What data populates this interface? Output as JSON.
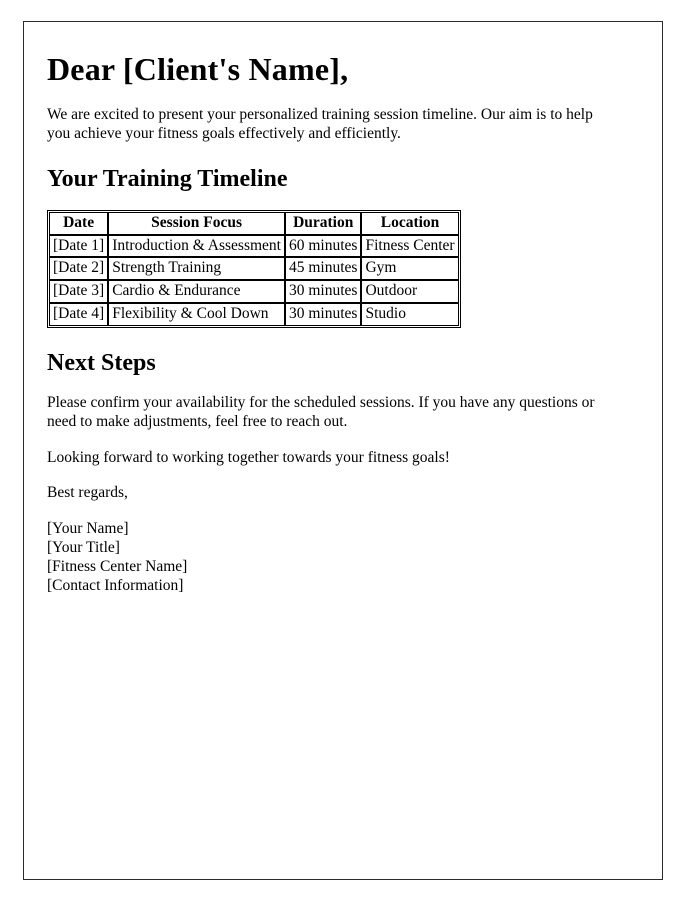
{
  "document": {
    "title": "Dear [Client's Name],",
    "intro_paragraph": "We are excited to present your personalized training session timeline. Our aim is to help you achieve your fitness goals effectively and efficiently.",
    "timeline_section": {
      "heading": "Your Training Timeline",
      "table": {
        "columns": [
          "Date",
          "Session Focus",
          "Duration",
          "Location"
        ],
        "rows": [
          [
            "[Date 1]",
            "Introduction & Assessment",
            "60 minutes",
            "Fitness Center"
          ],
          [
            "[Date 2]",
            "Strength Training",
            "45 minutes",
            "Gym"
          ],
          [
            "[Date 3]",
            "Cardio & Endurance",
            "30 minutes",
            "Outdoor"
          ],
          [
            "[Date 4]",
            "Flexibility & Cool Down",
            "30 minutes",
            "Studio"
          ]
        ]
      }
    },
    "next_steps_section": {
      "heading": "Next Steps",
      "paragraph_1": "Please confirm your availability for the scheduled sessions. If you have any questions or need to make adjustments, feel free to reach out.",
      "paragraph_2": "Looking forward to working together towards your fitness goals!"
    },
    "closing": {
      "salutation": "Best regards,",
      "signature_lines": [
        "[Your Name]",
        "[Your Title]",
        "[Fitness Center Name]",
        "[Contact Information]"
      ]
    }
  }
}
